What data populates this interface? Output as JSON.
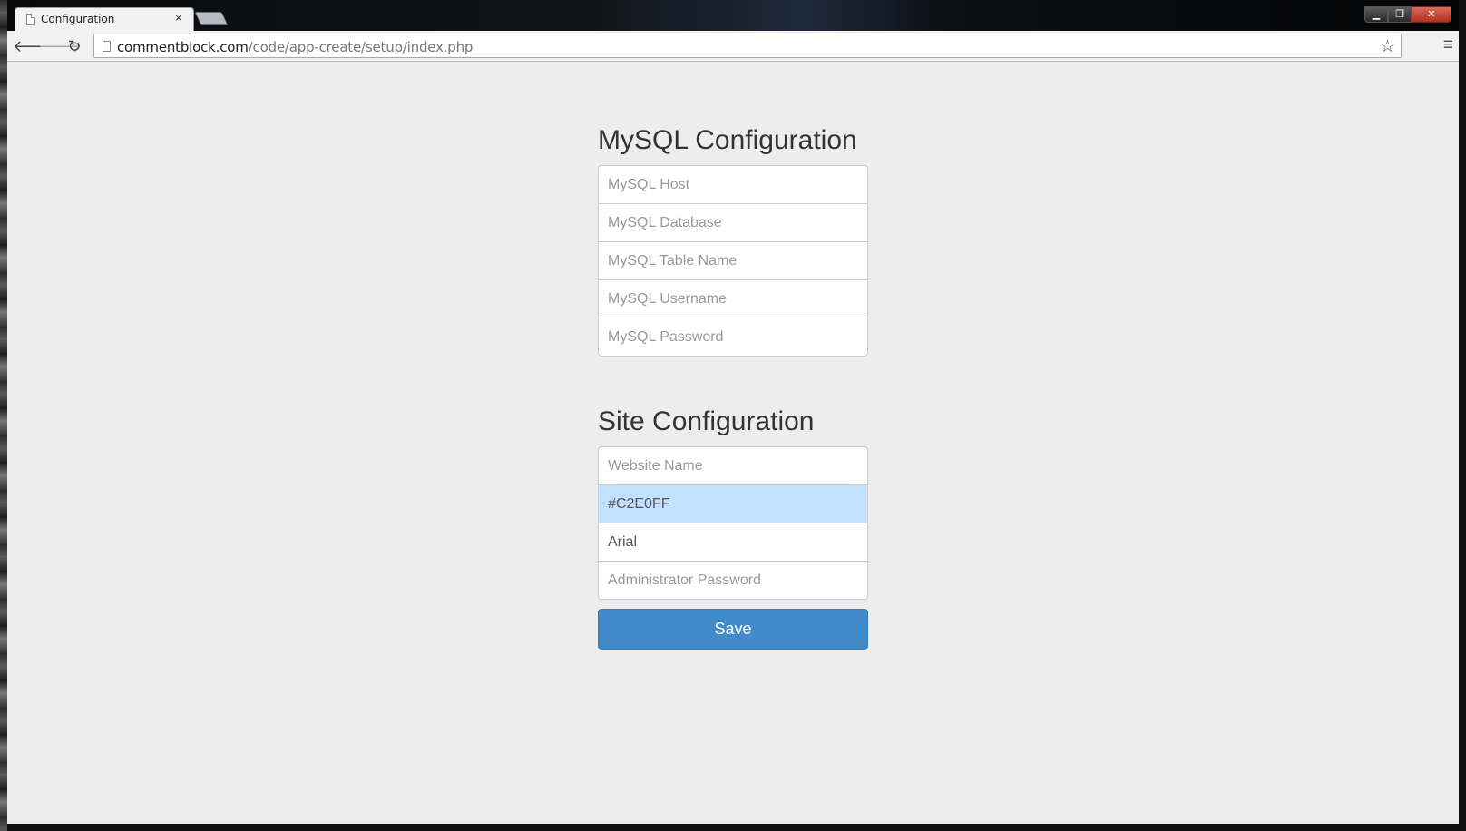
{
  "tab": {
    "title": "Configuration",
    "close": "×"
  },
  "window": {
    "minimize": "▁",
    "restore": "❐",
    "close": "✕"
  },
  "toolbar": {
    "url_domain": "commentblock.com",
    "url_path": "/code/app-create/setup/index.php"
  },
  "mysql": {
    "title": "MySQL Configuration",
    "host_placeholder": "MySQL Host",
    "database_placeholder": "MySQL Database",
    "table_placeholder": "MySQL Table Name",
    "username_placeholder": "MySQL Username",
    "password_placeholder": "MySQL Password"
  },
  "site": {
    "title": "Site Configuration",
    "name_placeholder": "Website Name",
    "color_value": "#C2E0FF",
    "font_value": "Arial",
    "admin_password_placeholder": "Administrator Password",
    "save_label": "Save"
  },
  "colors": {
    "accent": "#428bca",
    "color_field_bg": "#c2e0ff"
  }
}
